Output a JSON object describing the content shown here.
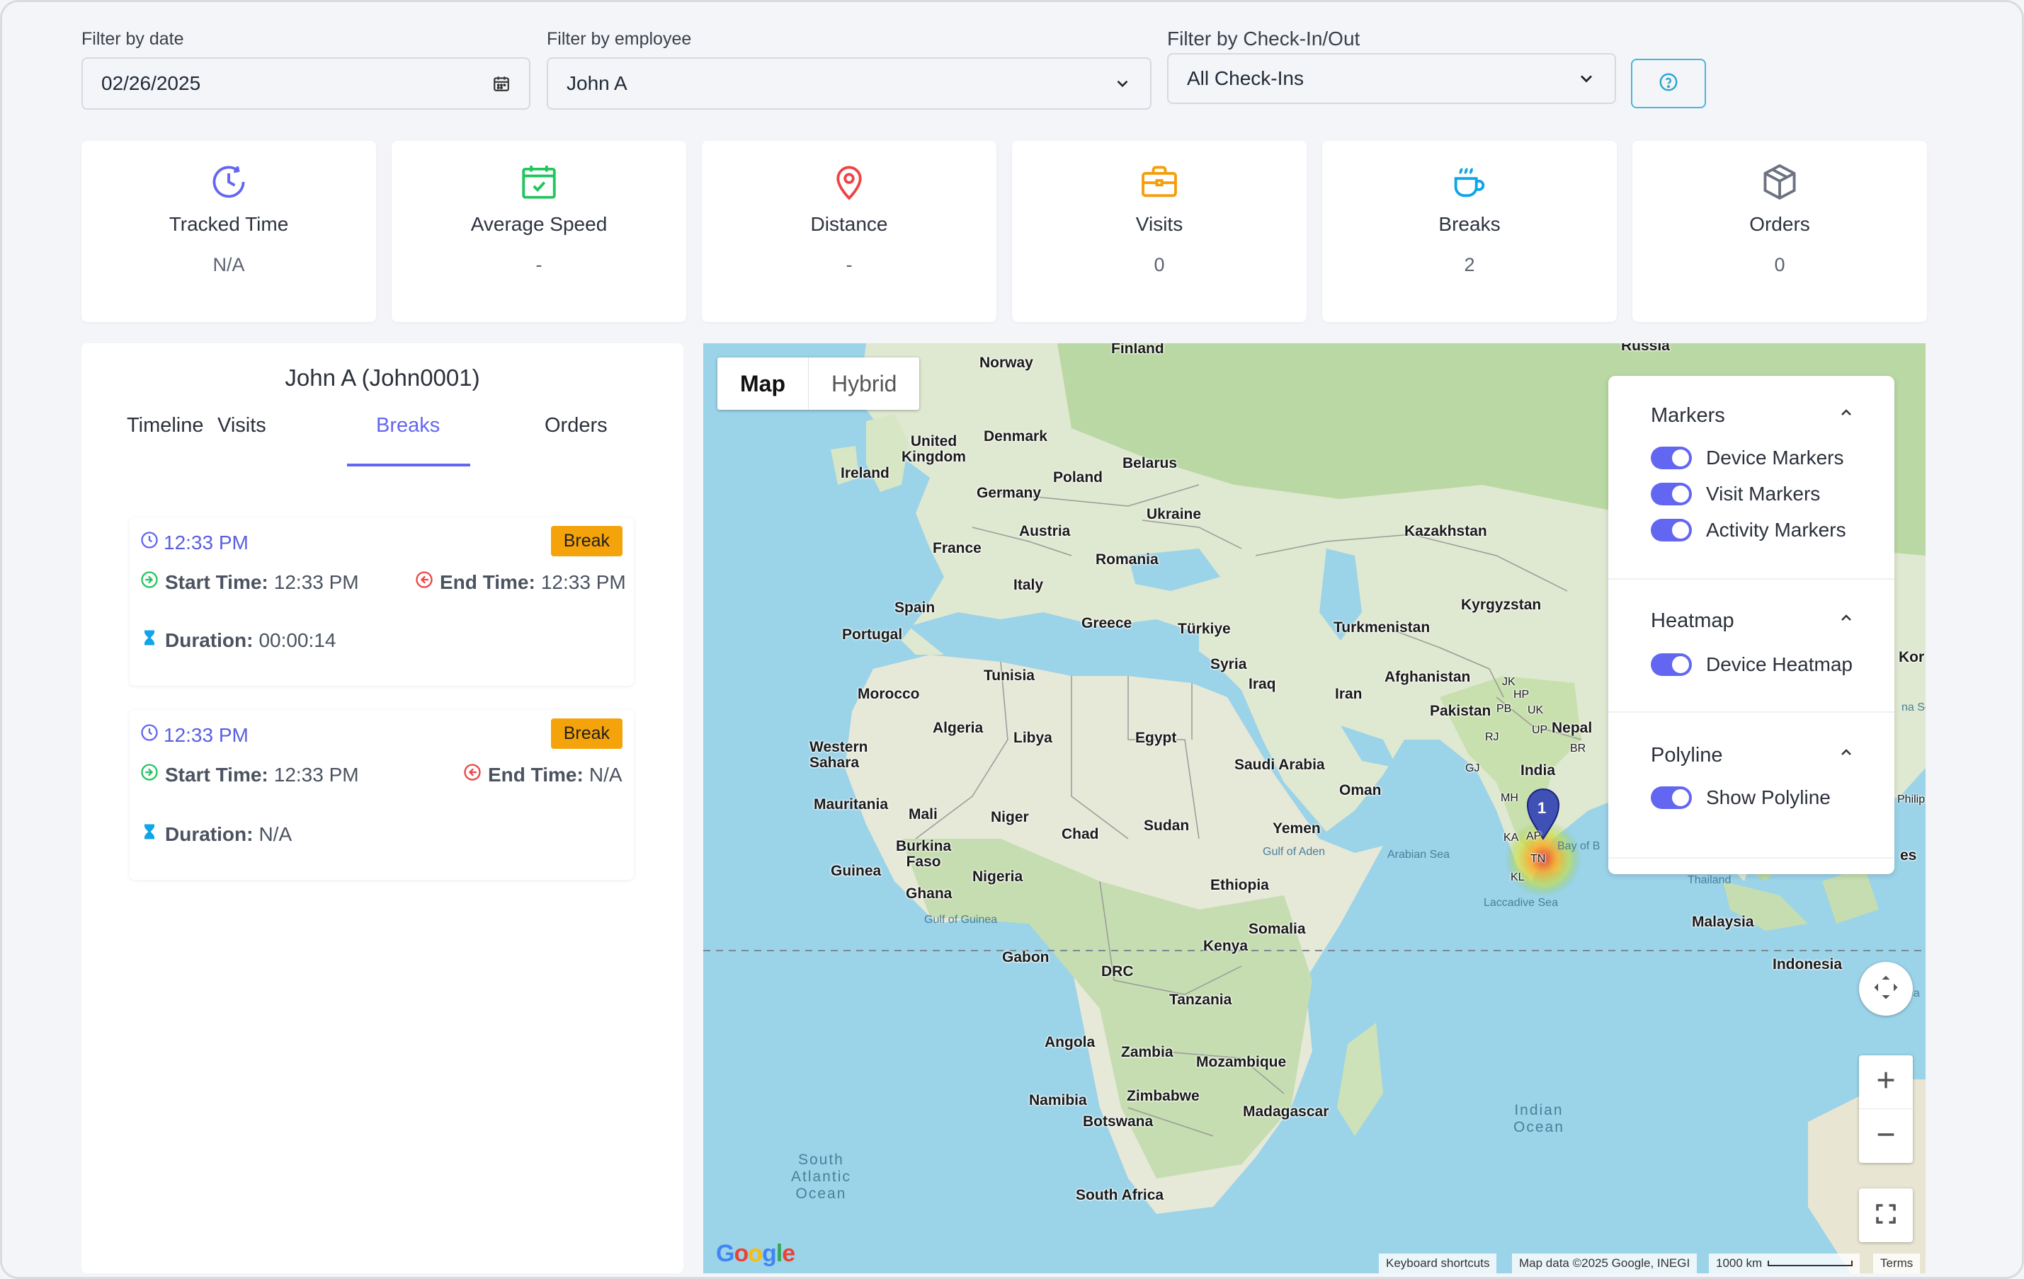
{
  "filters": {
    "date": {
      "label": "Filter by date",
      "value": "02/26/2025"
    },
    "employee": {
      "label": "Filter by employee",
      "value": "John A"
    },
    "checkinout": {
      "label": "Filter by Check-In/Out",
      "value": "All Check-Ins"
    }
  },
  "stats": [
    {
      "title": "Tracked Time",
      "value": "N/A",
      "icon": "clock-icon",
      "color": "#6366f1"
    },
    {
      "title": "Average Speed",
      "value": "-",
      "icon": "calendar-check-icon",
      "color": "#22c55e"
    },
    {
      "title": "Distance",
      "value": "-",
      "icon": "location-pin-icon",
      "color": "#ef4444"
    },
    {
      "title": "Visits",
      "value": "0",
      "icon": "briefcase-icon",
      "color": "#f59e0b"
    },
    {
      "title": "Breaks",
      "value": "2",
      "icon": "coffee-icon",
      "color": "#0ea5e9"
    },
    {
      "title": "Orders",
      "value": "0",
      "icon": "box-icon",
      "color": "#6b7280"
    }
  ],
  "panel": {
    "title": "John A (John0001)",
    "tabs": [
      "Timeline",
      "Visits",
      "Breaks",
      "Orders"
    ],
    "active_tab": "Breaks",
    "breaks": [
      {
        "time": "12:33 PM",
        "badge": "Break",
        "start_label": "Start Time:",
        "start_value": "12:33 PM",
        "end_label": "End Time:",
        "end_value": "12:33 PM",
        "duration_label": "Duration:",
        "duration_value": "00:00:14"
      },
      {
        "time": "12:33 PM",
        "badge": "Break",
        "start_label": "Start Time:",
        "start_value": "12:33 PM",
        "end_label": "End Time:",
        "end_value": "N/A",
        "duration_label": "Duration:",
        "duration_value": "N/A"
      }
    ]
  },
  "map": {
    "types": [
      "Map",
      "Hybrid"
    ],
    "selected_type": "Map",
    "layers": {
      "markers": {
        "title": "Markers",
        "items": [
          "Device Markers",
          "Visit Markers",
          "Activity Markers"
        ]
      },
      "heatmap": {
        "title": "Heatmap",
        "items": [
          "Device Heatmap"
        ]
      },
      "polyline": {
        "title": "Polyline",
        "items": [
          "Show Polyline"
        ]
      }
    },
    "marker_label": "1",
    "labels": {
      "finland": "Finland",
      "russia": "Russia",
      "norway": "Norway",
      "denmark": "Denmark",
      "uk": "United\nKingdom",
      "ireland": "Ireland",
      "belarus": "Belarus",
      "poland": "Poland",
      "germany": "Germany",
      "ukraine": "Ukraine",
      "austria": "Austria",
      "france": "France",
      "romania": "Romania",
      "kazakhstan": "Kazakhstan",
      "italy": "Italy",
      "spain": "Spain",
      "kyrgyzstan": "Kyrgyzstan",
      "portugal": "Portugal",
      "greece": "Greece",
      "turkiye": "Türkiye",
      "turkmenistan": "Turkmenistan",
      "syria": "Syria",
      "tunisia": "Tunisia",
      "iraq": "Iraq",
      "afghanistan": "Afghanistan",
      "morocco": "Morocco",
      "iran": "Iran",
      "pakistan": "Pakistan",
      "algeria": "Algeria",
      "libya": "Libya",
      "egypt": "Egypt",
      "nepal": "Nepal",
      "western_sahara": "Western\nSahara",
      "saudi": "Saudi Arabia",
      "india": "India",
      "oman": "Oman",
      "mauritania": "Mauritania",
      "mali": "Mali",
      "niger": "Niger",
      "sudan": "Sudan",
      "chad": "Chad",
      "yemen": "Yemen",
      "burkina": "Burkina\nFaso",
      "guinea": "Guinea",
      "nigeria": "Nigeria",
      "ghana": "Ghana",
      "ethiopia": "Ethiopia",
      "somalia": "Somalia",
      "kenya": "Kenya",
      "gabon": "Gabon",
      "drc": "DRC",
      "tanzania": "Tanzania",
      "angola": "Angola",
      "zambia": "Zambia",
      "mozambique": "Mozambique",
      "namibia": "Namibia",
      "zimbabwe": "Zimbabwe",
      "botswana": "Botswana",
      "madagascar": "Madagascar",
      "south_africa": "South Africa",
      "malaysia": "Malaysia",
      "indonesia": "Indonesia",
      "thailand": "Gulf of\nThailand",
      "philippines": "Philip",
      "korea": "Kor",
      "es": "es",
      "arabian_sea": "Arabian Sea",
      "gulf_of_aden": "Gulf of Aden",
      "gulf_of_guinea": "Gulf of Guinea",
      "laccadive": "Laccadive Sea",
      "bay_of_bengal": "Bay of B",
      "indian_ocean": "Indian\nOcean",
      "south_atlantic": "South\nAtlantic\nOcean",
      "na_se": "na Se",
      "ea": "ea",
      "jk": "JK",
      "hp": "HP",
      "pb": "PB",
      "uk_state": "UK",
      "up": "UP",
      "rj": "RJ",
      "br": "BR",
      "gj": "GJ",
      "mh": "MH",
      "ka": "KA",
      "tn": "TN",
      "kl": "KL",
      "ap": "AP"
    },
    "attribution": {
      "shortcuts": "Keyboard shortcuts",
      "data": "Map data ©2025 Google, INEGI",
      "scale": "1000 km",
      "terms": "Terms",
      "logo": "Google"
    }
  }
}
